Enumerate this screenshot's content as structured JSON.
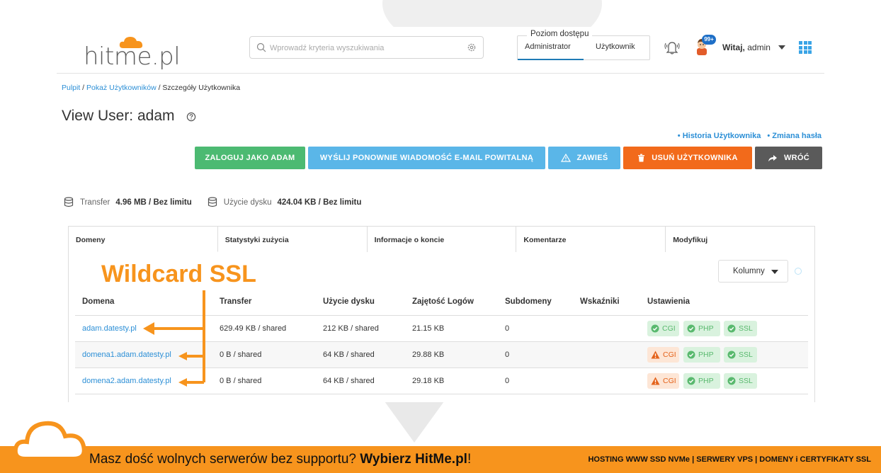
{
  "header": {
    "logo_text": "hitme.pl",
    "search_placeholder": "Wprowadź kryteria wyszukiwania",
    "access_legend": "Poziom dostępu",
    "access_admin": "Administrator",
    "access_user": "Użytkownik",
    "notification_badge": "99+",
    "greeting_bold": "Witaj,",
    "greeting_name": " admin"
  },
  "breadcrumb": {
    "item1": "Pulpit",
    "item2": "Pokaż Użytkowników",
    "item3": "Szczegóły Użytkownika",
    "sep": " / "
  },
  "page": {
    "title": "View User: adam"
  },
  "side_links": {
    "history": "• Historia Użytkownika",
    "password": "• Zmiana hasła"
  },
  "buttons": {
    "login": "ZALOGUJ JAKO ADAM",
    "resend_email": "WYŚLIJ PONOWNIE WIADOMOŚĆ E-MAIL POWITALNĄ",
    "suspend": "ZAWIEŚ",
    "delete": "USUŃ UŻYTKOWNIKA",
    "back": "WRÓĆ"
  },
  "usage": {
    "transfer_label": "Transfer",
    "transfer_value": "4.96 MB / Bez limitu",
    "disk_label": "Użycie dysku",
    "disk_value": "424.04 KB / Bez limitu"
  },
  "tabs": [
    "Domeny",
    "Statystyki zużycia",
    "Informacje o koncie",
    "Komentarze",
    "Modyfikuj"
  ],
  "columns_button": "Kolumny",
  "table": {
    "headers": [
      "Domena",
      "Transfer",
      "Użycie dysku",
      "Zajętość Logów",
      "Subdomeny",
      "Wskaźniki",
      "Ustawienia"
    ],
    "rows": [
      {
        "domain": "adam.datesty.pl",
        "transfer": "629.49 KB / shared",
        "disk": "212 KB / shared",
        "logs": "21.15 KB",
        "subdomains": "0",
        "cgi_status": "ok"
      },
      {
        "domain": "domena1.adam.datesty.pl",
        "transfer": "0 B / shared",
        "disk": "64 KB / shared",
        "logs": "29.88 KB",
        "subdomains": "0",
        "cgi_status": "warning"
      },
      {
        "domain": "domena2.adam.datesty.pl",
        "transfer": "0 B / shared",
        "disk": "64 KB / shared",
        "logs": "29.18 KB",
        "subdomains": "0",
        "cgi_status": "warning"
      }
    ],
    "pill_labels": {
      "cgi": "CGI",
      "php": "PHP",
      "ssl": "SSL"
    }
  },
  "annotation": {
    "title": "Wildcard SSL",
    "color": "#f7941d"
  },
  "banner": {
    "text_start": "Masz dość wolnych serwerów bez supportu? ",
    "text_bold": "Wybierz HitMe.pl",
    "text_end": "!",
    "right": "HOSTING WWW SSD NVMe | SERWERY VPS | DOMENY i CERTYFIKATY SSL"
  },
  "colors": {
    "brand_orange": "#f7941d",
    "link_blue": "#2c8fd6",
    "green": "#4cba72",
    "light_blue": "#5ab6e8",
    "red_orange": "#f26a1b",
    "dark_grey": "#5a5a5a"
  },
  "icons": {
    "search": "search-icon",
    "settings": "gear-icon",
    "bell": "bell-icon",
    "apps": "grid-icon",
    "help": "help-icon",
    "database": "database-icon",
    "warning": "warning-icon",
    "trash": "trash-icon",
    "share": "share-arrow-icon",
    "check": "check-circle-icon"
  }
}
